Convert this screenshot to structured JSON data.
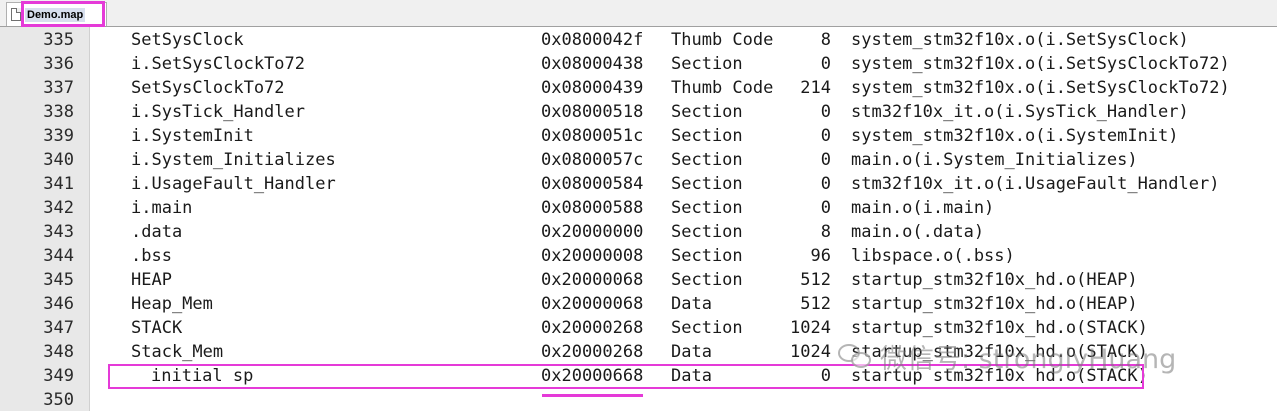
{
  "tab": {
    "label": "Demo.map",
    "icon": "file-icon"
  },
  "highlight_color": "#e53ad8",
  "watermark": "微信号: stronglyHuang",
  "rows": [
    {
      "ln": "335",
      "sym": "SetSysClock",
      "addr": "0x0800042f",
      "type": "Thumb Code",
      "size": "8",
      "obj": "system_stm32f10x.o(i.SetSysClock)"
    },
    {
      "ln": "336",
      "sym": "i.SetSysClockTo72",
      "addr": "0x08000438",
      "type": "Section",
      "size": "0",
      "obj": "system_stm32f10x.o(i.SetSysClockTo72)"
    },
    {
      "ln": "337",
      "sym": "SetSysClockTo72",
      "addr": "0x08000439",
      "type": "Thumb Code",
      "size": "214",
      "obj": "system_stm32f10x.o(i.SetSysClockTo72)"
    },
    {
      "ln": "338",
      "sym": "i.SysTick_Handler",
      "addr": "0x08000518",
      "type": "Section",
      "size": "0",
      "obj": "stm32f10x_it.o(i.SysTick_Handler)"
    },
    {
      "ln": "339",
      "sym": "i.SystemInit",
      "addr": "0x0800051c",
      "type": "Section",
      "size": "0",
      "obj": "system_stm32f10x.o(i.SystemInit)"
    },
    {
      "ln": "340",
      "sym": "i.System_Initializes",
      "addr": "0x0800057c",
      "type": "Section",
      "size": "0",
      "obj": "main.o(i.System_Initializes)"
    },
    {
      "ln": "341",
      "sym": "i.UsageFault_Handler",
      "addr": "0x08000584",
      "type": "Section",
      "size": "0",
      "obj": "stm32f10x_it.o(i.UsageFault_Handler)"
    },
    {
      "ln": "342",
      "sym": "i.main",
      "addr": "0x08000588",
      "type": "Section",
      "size": "0",
      "obj": "main.o(i.main)"
    },
    {
      "ln": "343",
      "sym": ".data",
      "addr": "0x20000000",
      "type": "Section",
      "size": "8",
      "obj": "main.o(.data)"
    },
    {
      "ln": "344",
      "sym": ".bss",
      "addr": "0x20000008",
      "type": "Section",
      "size": "96",
      "obj": "libspace.o(.bss)"
    },
    {
      "ln": "345",
      "sym": "HEAP",
      "addr": "0x20000068",
      "type": "Section",
      "size": "512",
      "obj": "startup_stm32f10x_hd.o(HEAP)"
    },
    {
      "ln": "346",
      "sym": "Heap_Mem",
      "addr": "0x20000068",
      "type": "Data",
      "size": "512",
      "obj": "startup_stm32f10x_hd.o(HEAP)"
    },
    {
      "ln": "347",
      "sym": "STACK",
      "addr": "0x20000268",
      "type": "Section",
      "size": "1024",
      "obj": "startup_stm32f10x_hd.o(STACK)"
    },
    {
      "ln": "348",
      "sym": "Stack_Mem",
      "addr": "0x20000268",
      "type": "Data",
      "size": "1024",
      "obj": "startup_stm32f10x_hd.o(STACK)"
    },
    {
      "ln": "349",
      "sym": "initial sp",
      "addr": "0x20000668",
      "type": "Data",
      "size": "0",
      "obj": "startup stm32f10x hd.o(STACK)"
    },
    {
      "ln": "350",
      "sym": "",
      "addr": "",
      "type": "",
      "size": "",
      "obj": ""
    }
  ]
}
